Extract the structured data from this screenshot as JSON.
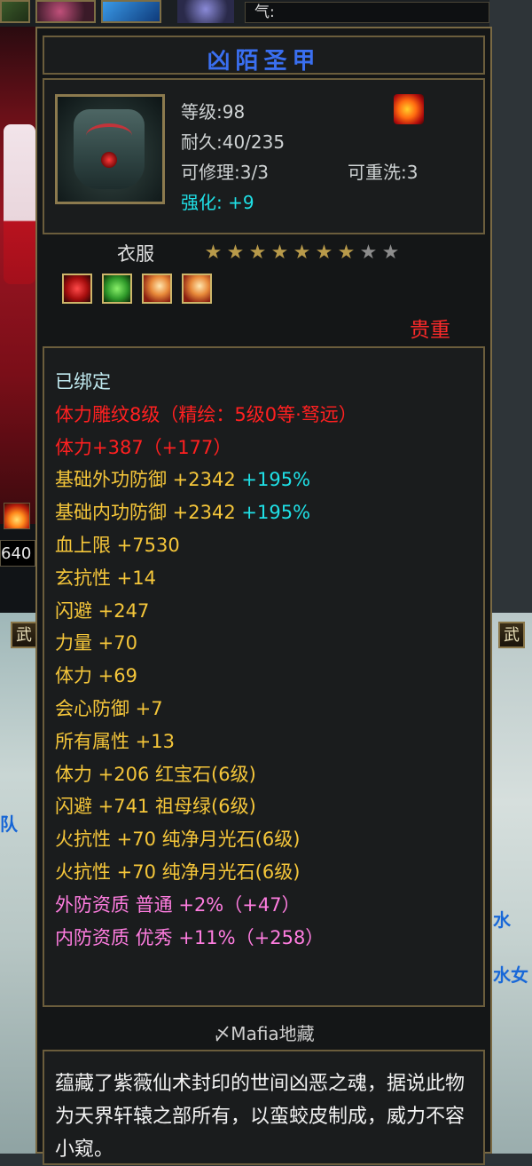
{
  "top_bar": {
    "qi_label": "气:"
  },
  "side": {
    "left_value": "640",
    "left_tab": "武",
    "right_tab": "武",
    "left_text": "队",
    "right_text_1": "水",
    "right_text_2": "水女"
  },
  "item": {
    "name": "凶陌圣甲",
    "stats": {
      "level": "等级:98",
      "durability": "耐久:40/235",
      "repairable": "可修理:3/3",
      "rewashable": "可重洗:3",
      "enhance_label": "强化:",
      "enhance_value": "+9"
    },
    "slot": "衣服",
    "stars": {
      "filled": 7,
      "total": 9
    },
    "gem_slots": [
      "ruby",
      "emerald",
      "moonstone",
      "moonstone"
    ],
    "rarity": "贵重",
    "attributes": [
      {
        "text": "已绑定",
        "color": "bind"
      },
      {
        "text": "体力雕纹8级（精绘：5级0等·驽远）",
        "color": "red"
      },
      {
        "text": "体力+387（+177）",
        "color": "red"
      },
      {
        "text": "基础外功防御 +2342 ",
        "extra": "+195%",
        "color": "gold"
      },
      {
        "text": "基础内功防御 +2342 ",
        "extra": "+195%",
        "color": "gold"
      },
      {
        "text": "血上限 +7530",
        "color": "gold"
      },
      {
        "text": "玄抗性 +14",
        "color": "gold"
      },
      {
        "text": "闪避 +247",
        "color": "gold"
      },
      {
        "text": "力量 +70",
        "color": "gold"
      },
      {
        "text": "体力 +69",
        "color": "gold"
      },
      {
        "text": "会心防御 +7",
        "color": "gold"
      },
      {
        "text": "所有属性 +13",
        "color": "gold"
      },
      {
        "text": "体力 +206 红宝石(6级)",
        "color": "gold"
      },
      {
        "text": "闪避 +741 祖母绿(6级)",
        "color": "gold"
      },
      {
        "text": "火抗性 +70 纯净月光石(6级)",
        "color": "gold"
      },
      {
        "text": "火抗性 +70 纯净月光石(6级)",
        "color": "gold"
      },
      {
        "text": "外防资质  普通 +2%（+47）",
        "color": "pink"
      },
      {
        "text": "内防资质  优秀 +11%（+258）",
        "color": "pink"
      }
    ],
    "owner": "〆Mafia地藏",
    "description": "蕴藏了紫薇仙术封印的世间凶恶之魂，据说此物为天界轩辕之部所有，以蛮蛟皮制成，威力不容小窥。"
  }
}
